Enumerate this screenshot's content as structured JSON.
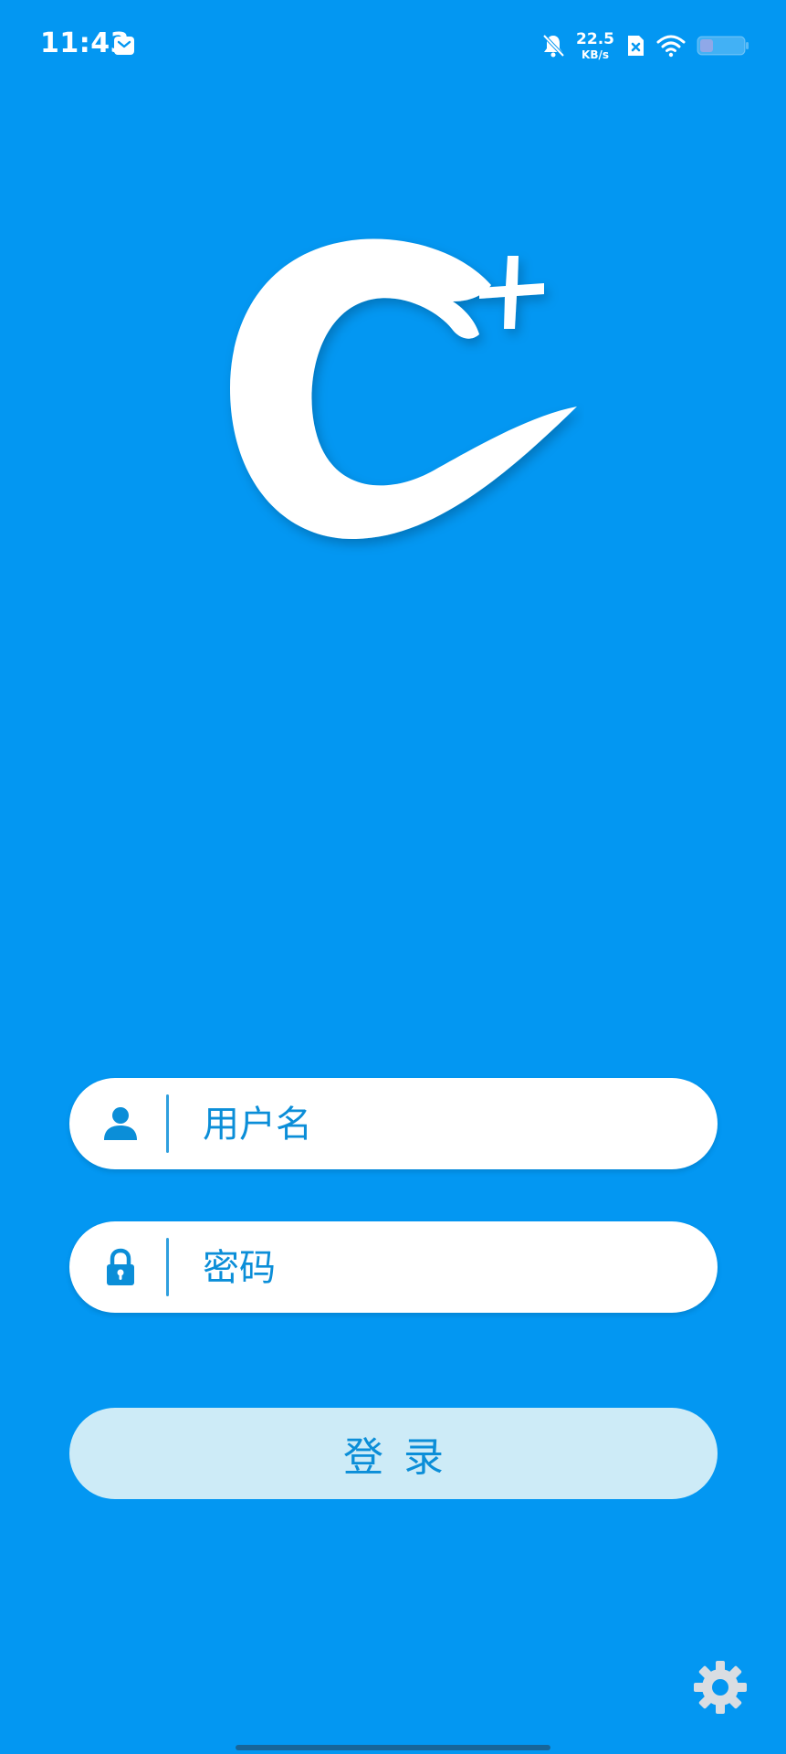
{
  "status_bar": {
    "time": "11:43",
    "net_speed_value": "22.5",
    "net_speed_unit": "KB/s",
    "icons": [
      "message-icon",
      "bell-muted-icon",
      "sim-off-icon",
      "wifi-icon",
      "battery-icon"
    ]
  },
  "logo": {
    "icon": "c-plus-logo"
  },
  "login_form": {
    "username": {
      "icon": "user-icon",
      "placeholder": "用户名",
      "value": ""
    },
    "password": {
      "icon": "lock-icon",
      "placeholder": "密码",
      "value": ""
    },
    "login_label": "登录"
  },
  "settings": {
    "icon": "gear-icon"
  },
  "colors": {
    "background": "#0397F2",
    "accent": "#0B8ED8",
    "button_bg": "#CDEBF7",
    "field_bg": "#FFFFFF"
  }
}
